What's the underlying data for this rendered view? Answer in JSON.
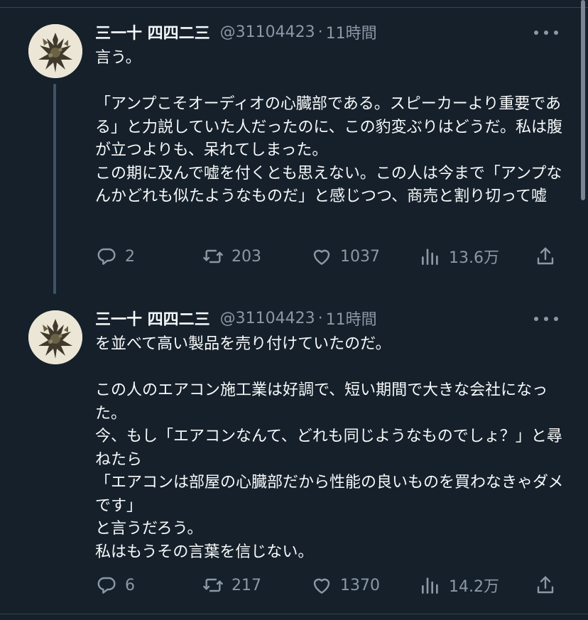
{
  "theme": {
    "background": "#15202b",
    "text_primary": "#f7f9f9",
    "text_secondary": "#8b98a5",
    "thread_line": "#3d5466"
  },
  "tweets": [
    {
      "display_name": "三一十 四四二三",
      "handle": "@31104423",
      "separator": "·",
      "time": "11時間",
      "text": "言う。\n\n「アンプこそオーディオの心臓部である。スピーカーより重要である」と力説していた人だったのに、この豹変ぶりはどうだ。私は腹が立つよりも、呆れてしまった。\nこの期に及んで嘘を付くとも思えない。この人は今まで「アンプなんかどれも似たようなものだ」と感じつつ、商売と割り切って嘘",
      "replies": "2",
      "retweets": "203",
      "likes": "1037",
      "views": "13.6万",
      "icons": [
        "reply-icon",
        "retweet-icon",
        "like-icon",
        "views-icon",
        "share-icon",
        "more-icon"
      ]
    },
    {
      "display_name": "三一十 四四二三",
      "handle": "@31104423",
      "separator": "·",
      "time": "11時間",
      "text": "を並べて高い製品を売り付けていたのだ。\n\nこの人のエアコン施工業は好調で、短い期間で大きな会社になった。\n今、もし「エアコンなんて、どれも同じようなものでしょ？」と尋ねたら\n「エアコンは部屋の心臓部だから性能の良いものを買わなきゃダメです」\nと言うだろう。\n私はもうその言葉を信じない。",
      "replies": "6",
      "retweets": "217",
      "likes": "1370",
      "views": "14.2万",
      "icons": [
        "reply-icon",
        "retweet-icon",
        "like-icon",
        "views-icon",
        "share-icon",
        "more-icon"
      ]
    }
  ]
}
